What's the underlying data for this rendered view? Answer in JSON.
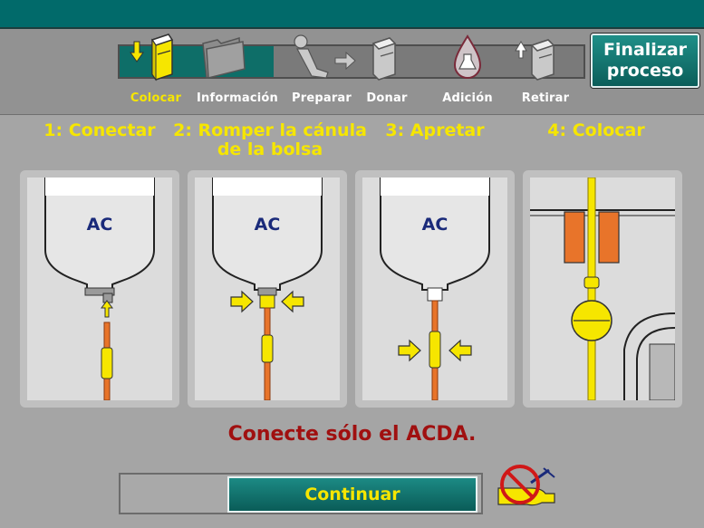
{
  "steps": [
    {
      "label": "Colocar",
      "active": true,
      "icon": "place-kit-icon"
    },
    {
      "label": "Información",
      "active": false,
      "icon": "info-folder-icon"
    },
    {
      "label": "Preparar",
      "active": false,
      "icon": "prepare-donor-icon"
    },
    {
      "label": "Donar",
      "active": false,
      "icon": "donate-icon"
    },
    {
      "label": "Adición",
      "active": false,
      "icon": "addition-drop-icon"
    },
    {
      "label": "Retirar",
      "active": false,
      "icon": "remove-kit-icon"
    }
  ],
  "finish_button": {
    "line1": "Finalizar",
    "line2": "proceso"
  },
  "instructions": [
    {
      "title_line1": "1: Conectar",
      "title_line2": "",
      "bag_label": "AC"
    },
    {
      "title_line1": "2: Romper la cánula",
      "title_line2": "de la bolsa",
      "bag_label": "AC"
    },
    {
      "title_line1": "3: Apretar",
      "title_line2": "",
      "bag_label": "AC"
    },
    {
      "title_line1": "4: Colocar",
      "title_line2": "",
      "bag_label": ""
    }
  ],
  "warning": "Conecte sólo el ACDA.",
  "continue_button": "Continuar",
  "colors": {
    "accent_teal": "#0e6e68",
    "highlight_yellow": "#f6e600",
    "warning_red": "#a01010",
    "tube_orange": "#e8742a"
  }
}
